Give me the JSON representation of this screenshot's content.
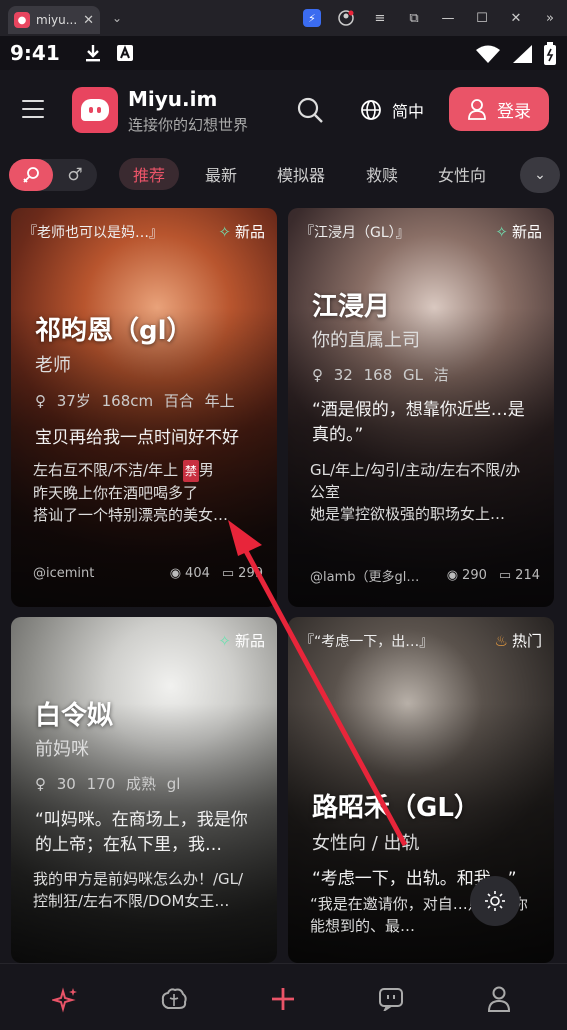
{
  "browser": {
    "tab_title": "miyu....",
    "tab_close": "✕",
    "dropdown": "⌄"
  },
  "statusbar": {
    "time": "9:41"
  },
  "header": {
    "brand_name": "Miyu.im",
    "tagline": "连接你的幻想世界",
    "language": "简中",
    "login_label": "登录"
  },
  "filters": {
    "tabs": [
      "推荐",
      "最新",
      "模拟器",
      "救赎",
      "女性向"
    ],
    "active_tab": "推荐"
  },
  "cards": [
    {
      "quote": "『老师也可以是妈…』",
      "badge": "新品",
      "name": "祁昀恩（gl）",
      "role": "老师",
      "meta": "♀ 37岁  168cm  百合  年上",
      "line": "宝贝再给我一点时间好不好",
      "desc_pre": "左右互不限/不洁/年上 ",
      "desc_tag": "禁",
      "desc_post": "男",
      "desc2": "昨天晚上你在酒吧喝多了",
      "desc3": "搭讪了一个特别漂亮的美女…",
      "author": "@icemint",
      "views": "404",
      "comments": "299"
    },
    {
      "quote": "『江浸月（GL）』",
      "badge": "新品",
      "name": "江浸月",
      "role": "你的直属上司",
      "meta": "♀ 32  168  GL  洁",
      "line": "“酒是假的，想靠你近些…是真的。”",
      "desc": "GL/年上/勾引/主动/左右不限/办公室",
      "desc2": "她是掌控欲极强的职场女上…",
      "author": "@lamb（更多gl…",
      "views": "290",
      "comments": "214"
    },
    {
      "badge": "新品",
      "name": "白令姒",
      "role": "前妈咪",
      "meta": "♀ 30  170  成熟  gl",
      "line": "“叫妈咪。在商场上，我是你的上帝；在私下里，我…",
      "desc": "我的甲方是前妈咪怎么办！/GL/控制狂/左右不限/DOM女王…"
    },
    {
      "quote": "『“考虑一下，出…』",
      "badge": "热门",
      "name": "路昭禾（GL）",
      "role": "女性向  / 出轨",
      "line": "“考虑一下，出轨。和我…”",
      "desc": "“我是在邀请你，对自…点。用你能想到的、最…"
    }
  ],
  "colors": {
    "accent": "#ea5468",
    "background": "#17161c",
    "arrow": "#e8253a"
  },
  "icons": {
    "nav": [
      "sparkle-icon",
      "brain-icon",
      "plus-icon",
      "chat-icon",
      "profile-icon"
    ]
  }
}
